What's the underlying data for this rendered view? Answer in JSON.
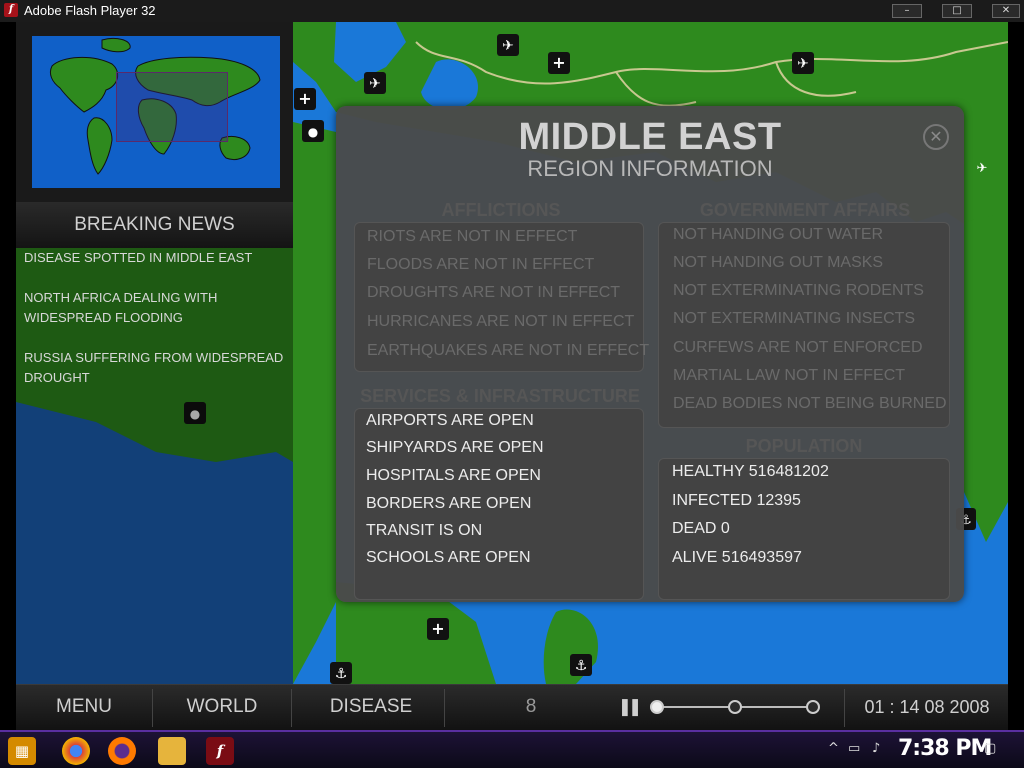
{
  "window": {
    "title": "Adobe Flash Player 32",
    "min_label": "–",
    "max_label": "□",
    "close_label": "✕"
  },
  "news": {
    "header": "BREAKING NEWS",
    "items": [
      "DISEASE SPOTTED IN MIDDLE EAST",
      "NORTH AFRICA DEALING WITH WIDESPREAD FLOODING",
      "RUSSIA SUFFERING FROM WIDESPREAD DROUGHT"
    ]
  },
  "dialog": {
    "title": "MIDDLE EAST",
    "subtitle": "REGION INFORMATION",
    "close": "✕",
    "afflictions": {
      "title": "AFFLICTIONS",
      "items": [
        "RIOTS ARE NOT IN EFFECT",
        "FLOODS ARE NOT IN EFFECT",
        "DROUGHTS ARE NOT IN EFFECT",
        "HURRICANES ARE NOT IN EFFECT",
        "EARTHQUAKES ARE NOT IN EFFECT"
      ]
    },
    "government": {
      "title": "GOVERNMENT AFFAIRS",
      "items": [
        "NOT HANDING OUT WATER",
        "NOT HANDING OUT MASKS",
        "NOT EXTERMINATING RODENTS",
        "NOT EXTERMINATING INSECTS",
        "CURFEWS ARE NOT ENFORCED",
        "MARTIAL LAW NOT IN EFFECT",
        "DEAD BODIES NOT BEING BURNED"
      ]
    },
    "services": {
      "title": "SERVICES & INFRASTRUCTURE",
      "items": [
        "AIRPORTS ARE OPEN",
        "SHIPYARDS ARE OPEN",
        "HOSPITALS ARE OPEN",
        "BORDERS ARE OPEN",
        "TRANSIT IS ON",
        "SCHOOLS ARE OPEN"
      ]
    },
    "population": {
      "title": "POPULATION",
      "items": [
        "HEALTHY 516481202",
        "INFECTED 12395",
        "DEAD 0",
        "ALIVE 516493597"
      ]
    }
  },
  "bottombar": {
    "menu": "MENU",
    "world": "WORLD",
    "disease": "DISEASE",
    "points": "8",
    "pause": "❚❚",
    "date": "01 : 14 08 2008",
    "speed_level": 1
  },
  "taskbar": {
    "clock": "7:38 PM"
  },
  "colors": {
    "ocean": "#1a78d8",
    "land": "#2e8a1e",
    "border_line": "#c8c890",
    "taskbar_accent": "#5a2fa0"
  }
}
